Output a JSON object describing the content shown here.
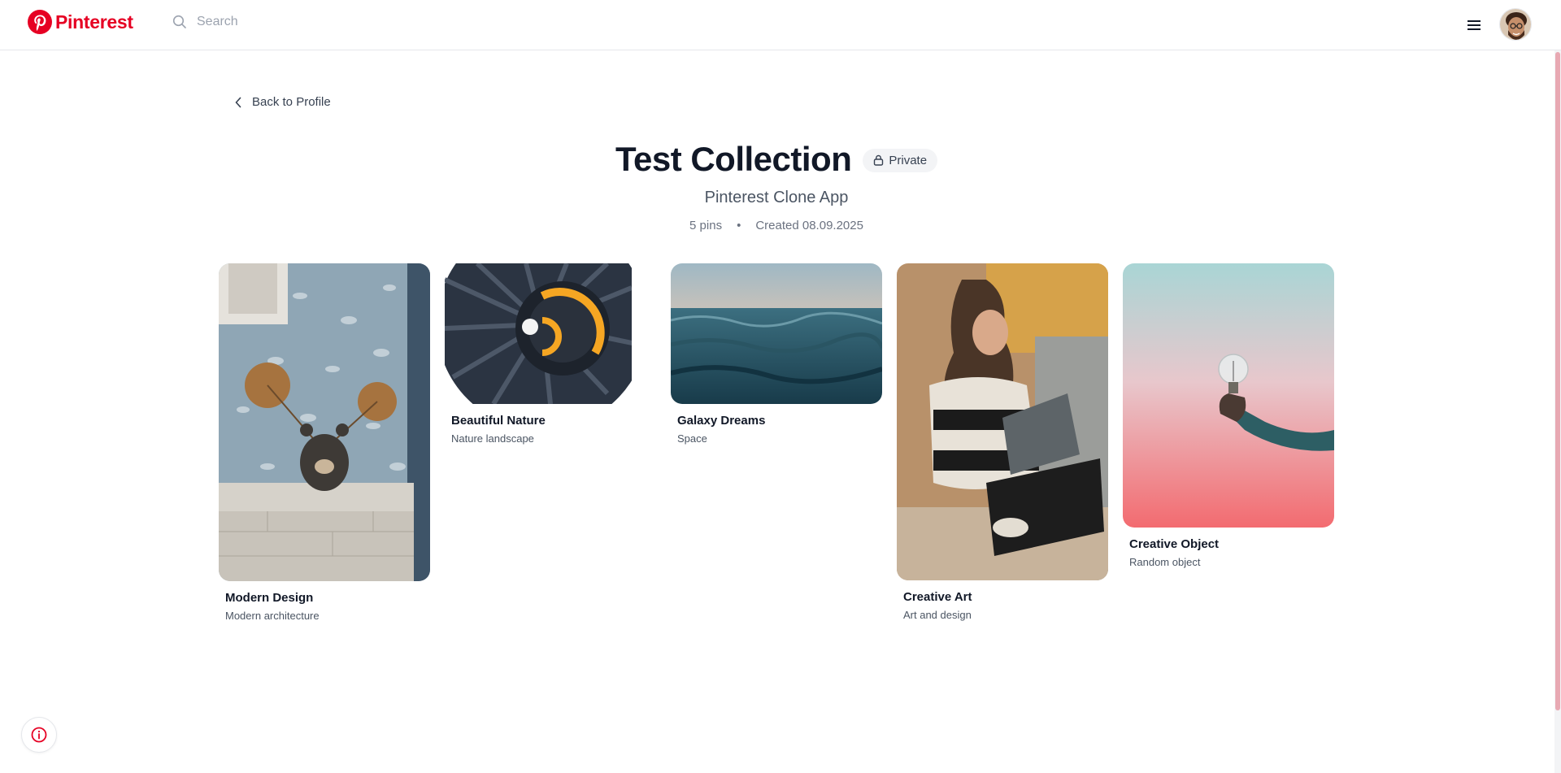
{
  "header": {
    "brand": "Pinterest",
    "search_placeholder": "Search"
  },
  "nav": {
    "back_label": "Back to Profile"
  },
  "collection": {
    "title": "Test Collection",
    "privacy_label": "Private",
    "subtitle": "Pinterest Clone App",
    "pin_count": "5 pins",
    "separator": "•",
    "created": "Created 08.09.2025"
  },
  "pins": [
    {
      "title": "Modern Design",
      "description": "Modern architecture"
    },
    {
      "title": "Beautiful Nature",
      "description": "Nature landscape"
    },
    {
      "title": "Galaxy Dreams",
      "description": "Space"
    },
    {
      "title": "Creative Art",
      "description": "Art and design"
    },
    {
      "title": "Creative Object",
      "description": "Random object"
    }
  ],
  "colors": {
    "brand": "#e60023",
    "text_primary": "#111827",
    "text_secondary": "#4b5563",
    "scroll_thumb": "#e8a9b3"
  },
  "icons": {
    "logo": "pinterest-logo-icon",
    "search": "search-icon",
    "menu": "hamburger-menu-icon",
    "back": "chevron-left-icon",
    "lock": "lock-icon",
    "info": "info-icon"
  }
}
